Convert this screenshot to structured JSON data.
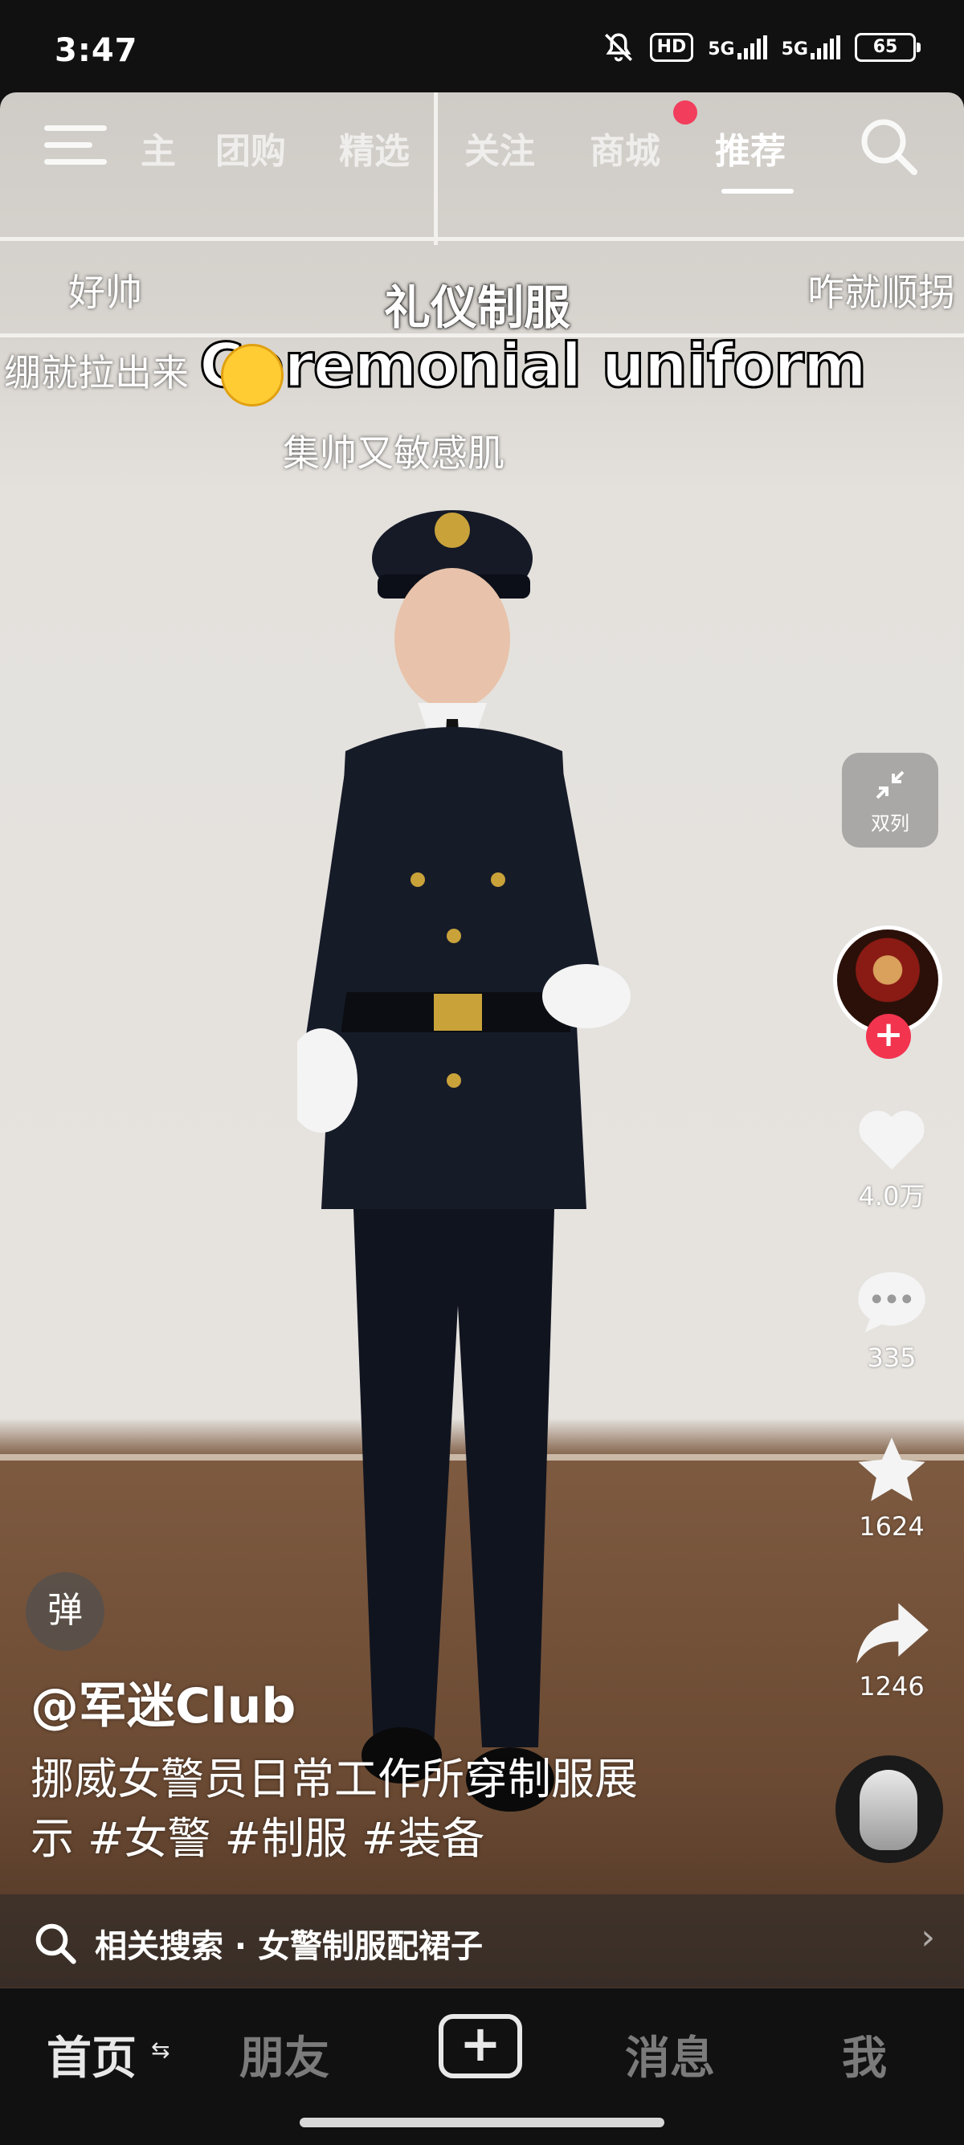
{
  "status_bar": {
    "time": "3:47",
    "hd_label": "HD",
    "net1": "5G",
    "net2": "5G",
    "battery": "65"
  },
  "top_tabs": [
    "主",
    "团购",
    "精选",
    "关注",
    "商城",
    "推荐"
  ],
  "active_tab": "推荐",
  "danmaku": [
    "好帅",
    "咋就顺拐",
    "绷就拉出来",
    "集帅又敏感肌"
  ],
  "captions": {
    "cn": "礼仪制服",
    "en": "Ceremonial uniform"
  },
  "right_rail": {
    "dual_label": "双列",
    "likes": "4.0万",
    "comments": "335",
    "favorites": "1624",
    "shares": "1246"
  },
  "danmu_toggle": "弹",
  "author": "@军迷Club",
  "description_line1": "挪威女警员日常工作所穿制服展",
  "description_line2": "示 #女警 #制服 #装备",
  "related_search": "相关搜索 · 女警制服配裙子",
  "bottom_tabs": {
    "home": "首页",
    "friends": "朋友",
    "messages": "消息",
    "me": "我"
  },
  "colors": {
    "accent_red": "#f23d5c",
    "follow_red": "#f2344f"
  }
}
